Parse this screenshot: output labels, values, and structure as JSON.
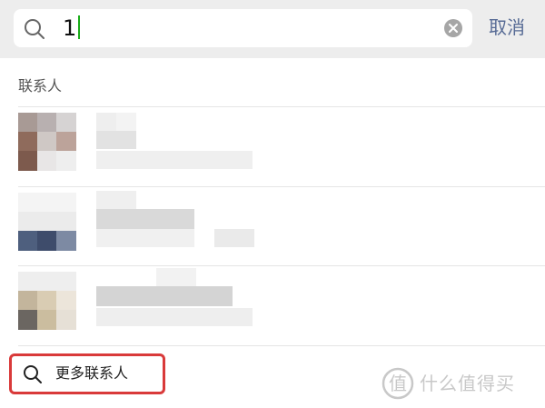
{
  "search": {
    "value": "1",
    "icon": "search-icon",
    "clear_icon": "clear-icon"
  },
  "header": {
    "cancel_label": "取消"
  },
  "section": {
    "title": "联系人"
  },
  "contacts": [
    {
      "blurred": true
    },
    {
      "blurred": true
    },
    {
      "blurred": true
    }
  ],
  "more": {
    "label": "更多联系人",
    "icon": "search-icon"
  },
  "watermark": {
    "text": "什么值得买"
  },
  "colors": {
    "topbar_bg": "#ededed",
    "link": "#576b95",
    "caret": "#1aad19",
    "highlight_border": "#d93a3a"
  }
}
